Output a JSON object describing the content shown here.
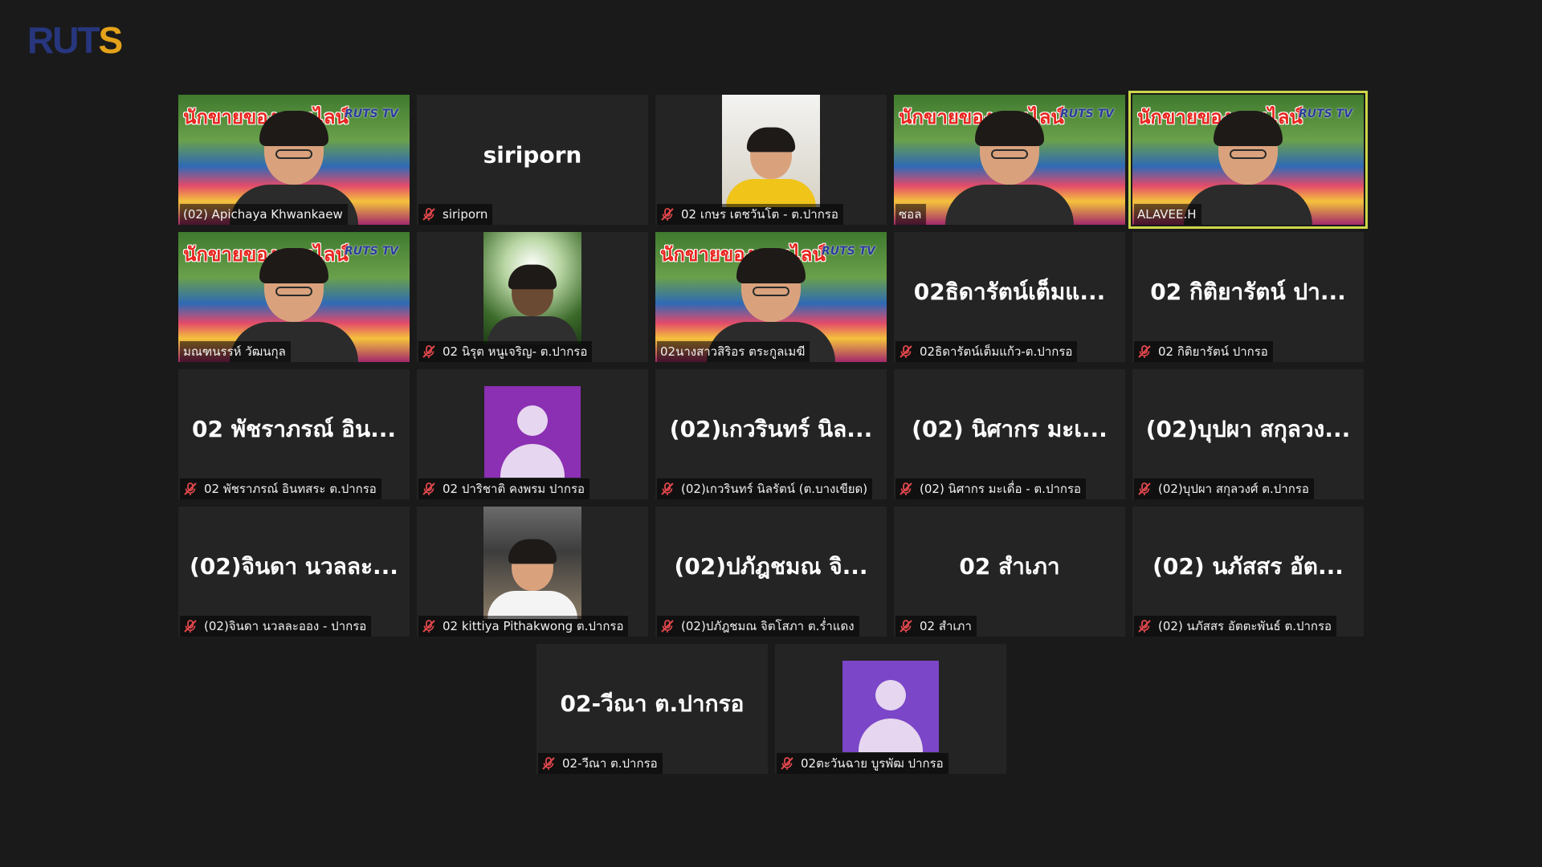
{
  "logo": {
    "letters_main": "RUT",
    "letters_accent": "S",
    "subtitle": ""
  },
  "banner": {
    "text": "นักขายของออนไลน์",
    "tv_logo": "RUTS TV"
  },
  "colors": {
    "background": "#1a1a1a",
    "tile": "#242424",
    "active_speaker_border": "#cdd74a",
    "muted_mic": "#e0474c",
    "avatar_purple": "#8b2fb3",
    "avatar_violet": "#7b46c7"
  },
  "tiles": [
    {
      "kind": "video",
      "label": "(02) Apichaya Khwankaew",
      "muted": false,
      "video": "garden"
    },
    {
      "kind": "name",
      "big_name": "siriporn",
      "label": "siriporn",
      "muted": true
    },
    {
      "kind": "video",
      "label": "02 เกษร เตชวันโต - ต.ปากรอ",
      "muted": true,
      "video": "portrait-light"
    },
    {
      "kind": "video",
      "label": "ซอล",
      "muted": false,
      "video": "garden"
    },
    {
      "kind": "video",
      "label": "ALAVEE.H",
      "muted": false,
      "video": "garden",
      "active_speaker": true
    },
    {
      "kind": "video",
      "label": "มณฑนรรห์ วัฒนกุล",
      "muted": false,
      "video": "garden"
    },
    {
      "kind": "video",
      "label": "02 นิรุต หนูเจริญ- ต.ปากรอ",
      "muted": true,
      "video": "portrait-tree"
    },
    {
      "kind": "video",
      "label": "02นางสาวสิริอร ตระกูลเมฆี",
      "muted": false,
      "video": "garden"
    },
    {
      "kind": "name",
      "big_name": "02ธิดารัตน์เต็มแ...",
      "label": "02ธิดารัตน์เต็มแก้ว-ต.ปากรอ",
      "muted": true
    },
    {
      "kind": "name",
      "big_name": "02 กิติยารัตน์ ปา...",
      "label": "02 กิติยารัตน์ ปากรอ",
      "muted": true
    },
    {
      "kind": "name",
      "big_name": "02 พัชราภรณ์ อิน...",
      "label": "02 พัชราภรณ์ อินทสระ ต.ปากรอ",
      "muted": true
    },
    {
      "kind": "avatar",
      "label": "02 ปาริชาติ คงพรม ปากรอ",
      "muted": true,
      "avatar_color": "purple"
    },
    {
      "kind": "name",
      "big_name": "(02)เกวรินทร์ นิล...",
      "label": "(02)เกวรินทร์ นิลรัตน์ (ต.บางเขียด)",
      "muted": true
    },
    {
      "kind": "name",
      "big_name": "(02) นิศากร มะเ...",
      "label": "(02) นิศากร มะเดื่อ - ต.ปากรอ",
      "muted": true
    },
    {
      "kind": "name",
      "big_name": "(02)บุปผา สกุลวง...",
      "label": "(02)บุปผา สกุลวงศ์ ต.ปากรอ",
      "muted": true
    },
    {
      "kind": "name",
      "big_name": "(02)จินดา นวลละ...",
      "label": "(02)จินดา นวลละออง - ปากรอ",
      "muted": true
    },
    {
      "kind": "video",
      "label": "02 kittiya Pithakwong ต.ปากรอ",
      "muted": true,
      "video": "portrait-room"
    },
    {
      "kind": "name",
      "big_name": "(02)ปภัฎชมณ จิ...",
      "label": "(02)ปภัฎชมณ จิตโสภา ต.ร่ำแดง",
      "muted": true
    },
    {
      "kind": "name",
      "big_name": "02 สำเภา",
      "label": "02 สำเภา",
      "muted": true
    },
    {
      "kind": "name",
      "big_name": "(02) นภัสสร อัต...",
      "label": "(02) นภัสสร อัตตะพันธ์ ต.ปากรอ",
      "muted": true
    },
    {
      "kind": "name",
      "big_name": "02-วีณา ต.ปากรอ",
      "label": "02-วีณา ต.ปากรอ",
      "muted": true
    },
    {
      "kind": "avatar",
      "label": "02ตะวันฉาย บูรพัฒ ปากรอ",
      "muted": true,
      "avatar_color": "violet"
    }
  ]
}
